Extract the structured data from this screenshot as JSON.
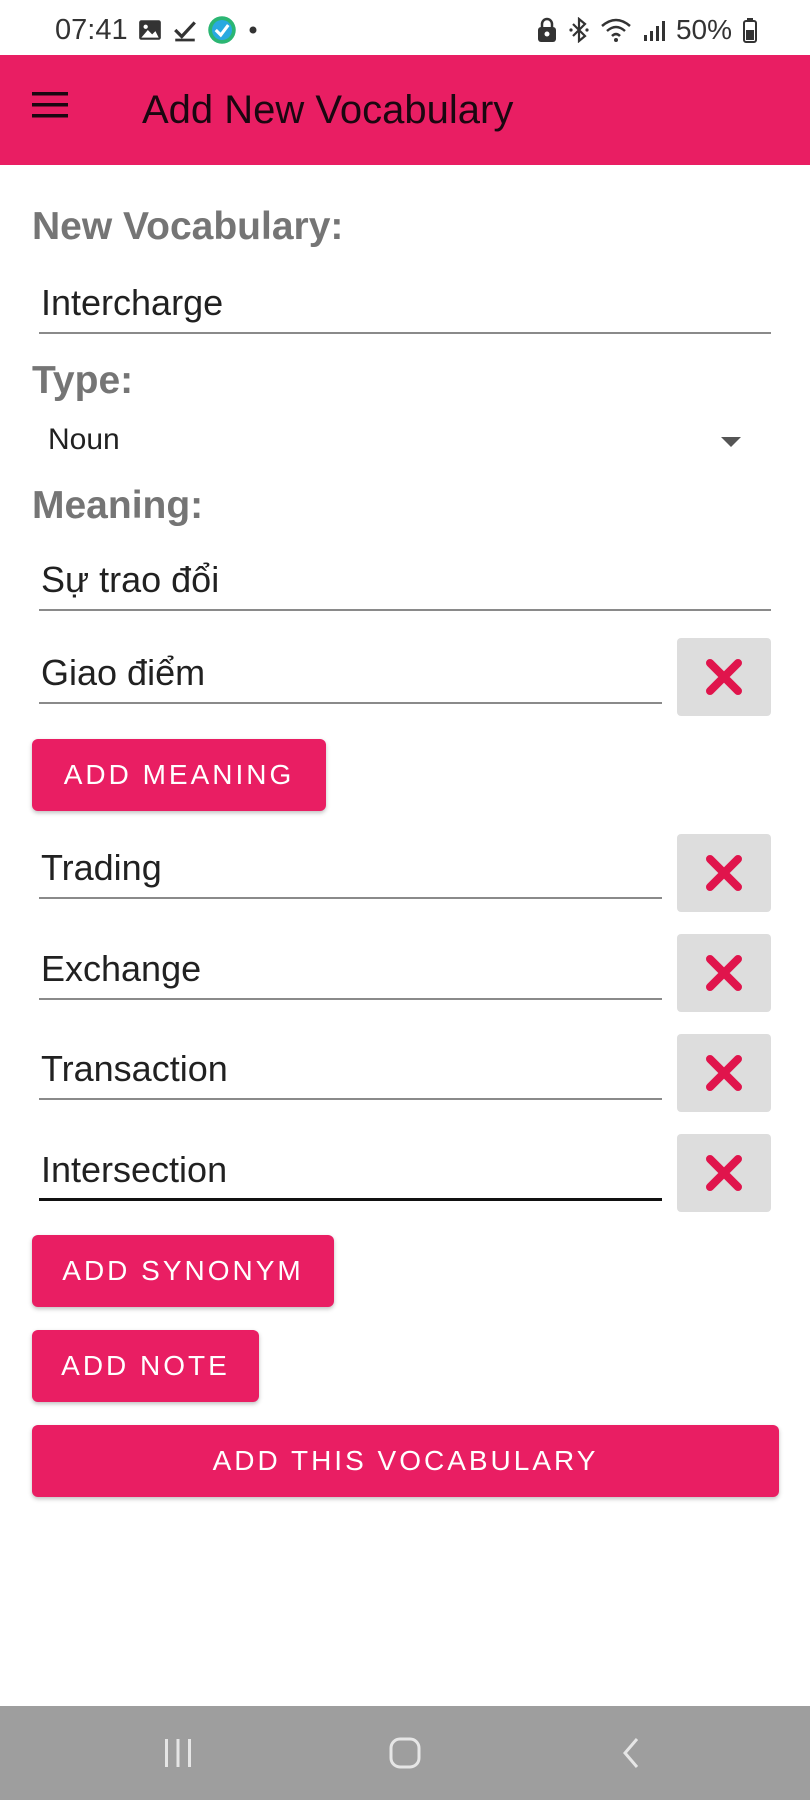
{
  "status_bar": {
    "time": "07:41",
    "battery": "50%",
    "left_icons": [
      "image-icon",
      "download-done-icon",
      "app-check-icon",
      "dot-icon"
    ],
    "right_icons": [
      "lock-icon",
      "bluetooth-icon",
      "wifi-icon",
      "signal-icon",
      "battery-icon"
    ]
  },
  "app_bar": {
    "title": "Add New Vocabulary",
    "menu_icon": "hamburger-menu-icon"
  },
  "form": {
    "vocab_label": "New Vocabulary:",
    "vocab_value": "Intercharge",
    "type_label": "Type:",
    "type_value": "Noun",
    "meaning_label": "Meaning:",
    "meanings": [
      "Sự trao đổi",
      "Giao điểm"
    ],
    "add_meaning_label": "ADD MEANING",
    "synonyms": [
      "Trading",
      "Exchange",
      "Transaction",
      "Intersection"
    ],
    "add_synonym_label": "ADD SYNONYM",
    "add_note_label": "ADD NOTE",
    "add_vocab_label": "ADD THIS VOCABULARY"
  },
  "colors": {
    "accent": "#e91e63",
    "remove_icon": "#e0144c",
    "remove_bg": "#dddddd",
    "nav_bar": "#9e9e9e"
  },
  "nav_bar": {
    "buttons": [
      "recents-icon",
      "home-icon",
      "back-icon"
    ]
  }
}
